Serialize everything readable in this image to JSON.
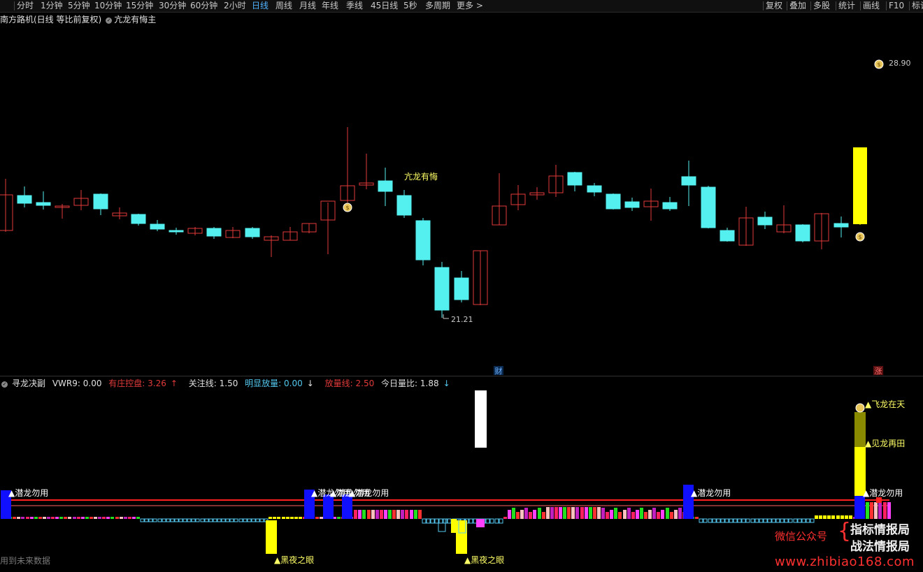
{
  "toolbar": {
    "periods": [
      "分时",
      "1分钟",
      "5分钟",
      "10分钟",
      "15分钟",
      "30分钟",
      "60分钟",
      "2小时",
      "日线",
      "周线",
      "月线",
      "年线",
      "季线",
      "45日线",
      "5秒",
      "多周期",
      "更多 >"
    ],
    "active_period": "日线",
    "right_buttons": [
      "复权",
      "叠加",
      "多股",
      "统计",
      "画线",
      "F10",
      "标记"
    ]
  },
  "main_chart": {
    "title": "南方路机(日线 等比前复权)",
    "indicator": "亢龙有悔主",
    "price_high_label": "28.90",
    "price_low_label": "21.21",
    "signal_label": "亢龙有悔",
    "badge_cai": "财",
    "badge_zhang": "涨",
    "colors": {
      "up": "#e23a3a",
      "down": "#54f0f0",
      "signal": "#ffff00"
    }
  },
  "sub_chart": {
    "name": "寻龙决副",
    "vwr": "VWR9: 0.00",
    "youzhuang": "有庄控盘: 3.26",
    "guanzhu": "关注线: 1.50",
    "mingxian": "明显放量: 0.00",
    "fangliang": "放量线: 2.50",
    "jinri": "今日量比: 1.88",
    "labels": {
      "qianlong": "潜龙勿用",
      "heiye": "黑夜之眼",
      "feilong": "飞龙在天",
      "jianlong": "见龙再田"
    }
  },
  "footer_note": "用到未来数据",
  "watermark": {
    "line1": "指标情报局",
    "line2": "战法情报局",
    "wechat": "微信公众号",
    "url": "www.zhibiao168.com"
  }
}
